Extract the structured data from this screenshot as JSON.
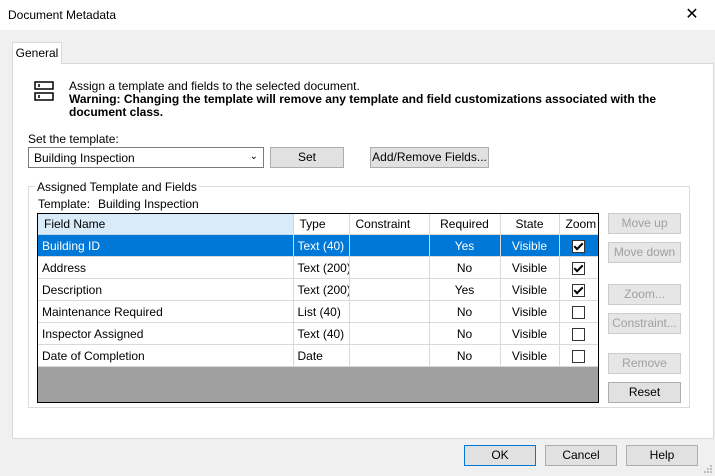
{
  "window": {
    "title": "Document Metadata",
    "close_glyph": "✕"
  },
  "tabs": [
    {
      "label": "General"
    }
  ],
  "info": {
    "icon": "fields-icon",
    "line1": "Assign a template and fields to the selected document.",
    "warning": "Warning: Changing the template will remove any template and field customizations associated with the document class."
  },
  "template_select": {
    "label": "Set the template:",
    "value": "Building Inspection",
    "set_button": "Set",
    "add_remove_button": "Add/Remove Fields..."
  },
  "assigned": {
    "group_title": "Assigned Template and Fields",
    "template_label": "Template:",
    "template_value": "Building Inspection",
    "columns": [
      "Field Name",
      "Type",
      "Constraint",
      "Required",
      "State",
      "Zoom"
    ],
    "rows": [
      {
        "name": "Building ID",
        "type": "Text (40)",
        "constraint": "",
        "required": "Yes",
        "state": "Visible",
        "zoom": true,
        "selected": true
      },
      {
        "name": "Address",
        "type": "Text (200)",
        "constraint": "",
        "required": "No",
        "state": "Visible",
        "zoom": true,
        "selected": false
      },
      {
        "name": "Description",
        "type": "Text (200)",
        "constraint": "",
        "required": "Yes",
        "state": "Visible",
        "zoom": true,
        "selected": false
      },
      {
        "name": "Maintenance Required",
        "type": "List (40)",
        "constraint": "",
        "required": "No",
        "state": "Visible",
        "zoom": false,
        "selected": false
      },
      {
        "name": "Inspector Assigned",
        "type": "Text (40)",
        "constraint": "",
        "required": "No",
        "state": "Visible",
        "zoom": false,
        "selected": false
      },
      {
        "name": "Date of Completion",
        "type": "Date",
        "constraint": "",
        "required": "No",
        "state": "Visible",
        "zoom": false,
        "selected": false
      }
    ]
  },
  "side_buttons": {
    "move_up": "Move up",
    "move_down": "Move down",
    "zoom": "Zoom...",
    "constraint": "Constraint...",
    "remove": "Remove",
    "reset": "Reset"
  },
  "footer": {
    "ok": "OK",
    "cancel": "Cancel",
    "help": "Help"
  },
  "colors": {
    "selection": "#0078d7",
    "header_highlight": "#d9ebf9",
    "grid_empty": "#a0a0a0"
  }
}
